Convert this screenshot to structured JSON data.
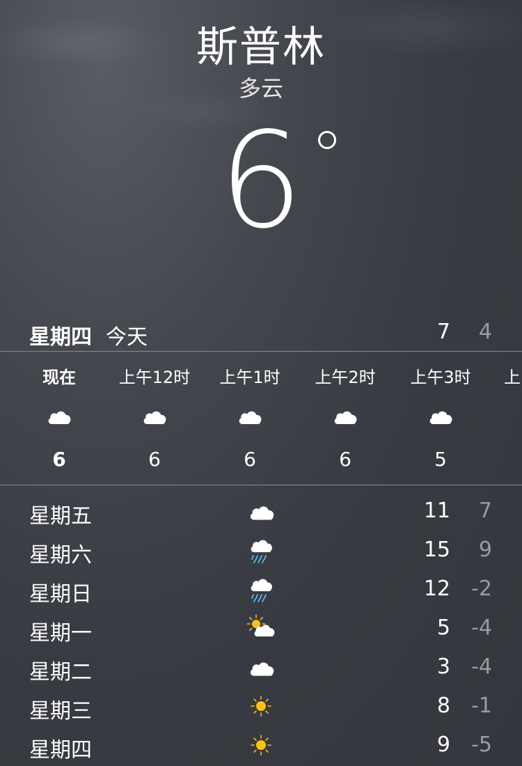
{
  "header": {
    "city": "斯普林",
    "condition": "多云",
    "temperature": "6"
  },
  "today": {
    "day": "星期四",
    "label": "今天",
    "high": "7",
    "low": "4"
  },
  "hourly": [
    {
      "time": "现在",
      "icon": "cloud-icon",
      "temp": "6"
    },
    {
      "time": "上午12时",
      "icon": "cloud-icon",
      "temp": "6"
    },
    {
      "time": "上午1时",
      "icon": "cloud-icon",
      "temp": "6"
    },
    {
      "time": "上午2时",
      "icon": "cloud-icon",
      "temp": "6"
    },
    {
      "time": "上午3时",
      "icon": "cloud-icon",
      "temp": "5"
    },
    {
      "time": "上",
      "icon": "",
      "temp": ""
    }
  ],
  "daily": [
    {
      "day": "星期五",
      "icon": "cloud-icon",
      "high": "11",
      "low": "7"
    },
    {
      "day": "星期六",
      "icon": "rain-icon",
      "high": "15",
      "low": "9"
    },
    {
      "day": "星期日",
      "icon": "rain-icon",
      "high": "12",
      "low": "-2"
    },
    {
      "day": "星期一",
      "icon": "partly-sunny-icon",
      "high": "5",
      "low": "-4"
    },
    {
      "day": "星期二",
      "icon": "cloud-icon",
      "high": "3",
      "low": "-4"
    },
    {
      "day": "星期三",
      "icon": "sun-icon",
      "high": "8",
      "low": "-1"
    },
    {
      "day": "星期四",
      "icon": "sun-icon",
      "high": "9",
      "low": "-5"
    }
  ],
  "colors": {
    "sun": "#f7c21a",
    "rain": "#5bb8f0",
    "cloud": "#ffffff",
    "dim_text": "#9a9ba0"
  }
}
